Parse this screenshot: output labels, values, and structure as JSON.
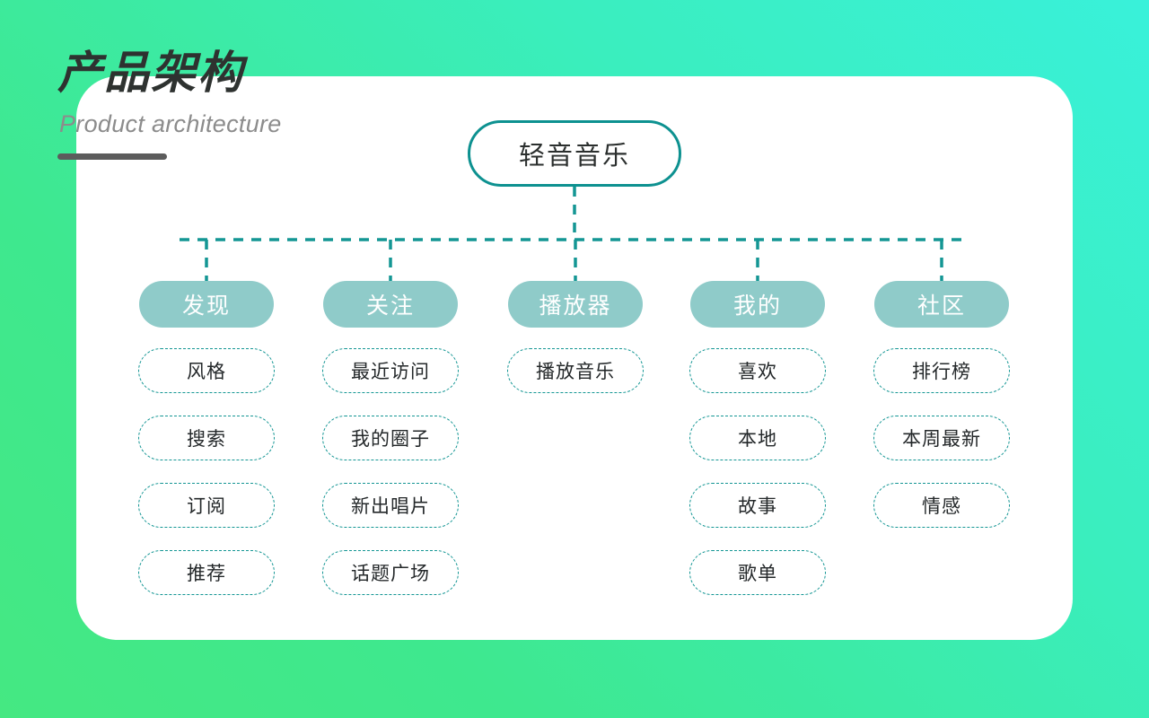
{
  "header": {
    "title_cn": "产品架构",
    "title_en": "Product architecture"
  },
  "colors": {
    "background_start": "#45E882",
    "background_end": "#39F1DA",
    "card": "#FFFFFF",
    "accent_teal": "#0D9190",
    "category_fill": "#8FCBC9",
    "connector": "#149694",
    "title_text": "#2E3230",
    "subtitle_text": "#8C8C8C",
    "rule": "#5C5C5C"
  },
  "diagram": {
    "root": {
      "label": "轻音音乐"
    },
    "columns": [
      {
        "category": "发现",
        "children": [
          {
            "label": "风格"
          },
          {
            "label": "搜索"
          },
          {
            "label": "订阅"
          },
          {
            "label": "推荐"
          }
        ]
      },
      {
        "category": "关注",
        "children": [
          {
            "label": "最近访问"
          },
          {
            "label": "我的圈子"
          },
          {
            "label": "新出唱片"
          },
          {
            "label": "话题广场"
          }
        ]
      },
      {
        "category": "播放器",
        "children": [
          {
            "label": "播放音乐"
          }
        ]
      },
      {
        "category": "我的",
        "children": [
          {
            "label": "喜欢"
          },
          {
            "label": "本地"
          },
          {
            "label": "故事"
          },
          {
            "label": "歌单"
          }
        ]
      },
      {
        "category": "社区",
        "children": [
          {
            "label": "排行榜"
          },
          {
            "label": "本周最新"
          },
          {
            "label": "情感"
          }
        ]
      }
    ]
  }
}
